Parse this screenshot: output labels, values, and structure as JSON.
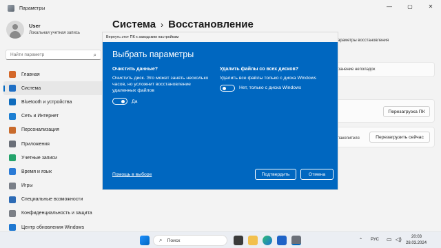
{
  "window": {
    "title": "Параметры",
    "minimize": "—",
    "maximize": "▢",
    "close": "✕"
  },
  "user": {
    "name": "User",
    "account_type": "Локальная учетная запись"
  },
  "search": {
    "placeholder": "Найти параметр"
  },
  "nav": [
    {
      "label": "Главная",
      "icon": "home-icon",
      "color": "#d4682a"
    },
    {
      "label": "Система",
      "icon": "monitor-icon",
      "color": "#1f6fc5",
      "active": true
    },
    {
      "label": "Bluetooth и устройства",
      "icon": "bluetooth-icon",
      "color": "#0f6cbd"
    },
    {
      "label": "Сеть и Интернет",
      "icon": "wifi-icon",
      "color": "#1d7fd2"
    },
    {
      "label": "Персонализация",
      "icon": "brush-icon",
      "color": "#c96b2c"
    },
    {
      "label": "Приложения",
      "icon": "apps-icon",
      "color": "#6a6f78"
    },
    {
      "label": "Учетные записи",
      "icon": "account-icon",
      "color": "#24a36b"
    },
    {
      "label": "Время и язык",
      "icon": "globe-clock-icon",
      "color": "#2b7bd6"
    },
    {
      "label": "Игры",
      "icon": "gamepad-icon",
      "color": "#7a7f88"
    },
    {
      "label": "Специальные возможности",
      "icon": "accessibility-icon",
      "color": "#2d6bb5"
    },
    {
      "label": "Конфиденциальность и защита",
      "icon": "shield-icon",
      "color": "#7b7f86"
    },
    {
      "label": "Центр обновления Windows",
      "icon": "update-icon",
      "color": "#1f78d1"
    }
  ],
  "page": {
    "section": "Система",
    "title": "Восстановление"
  },
  "background": {
    "partial_text_1": "араметры восстановления",
    "partial_text_2": "ранение неполадок",
    "partial_text_3": "пакопителя",
    "restart_button": "Перезагрузка ПК",
    "restart_now_button": "Перезагрузить сейчас"
  },
  "dialog": {
    "title": "Вернуть этот ПК к заводским настройкам",
    "heading": "Выбрать параметры",
    "clean": {
      "title": "Очистить данные?",
      "desc": [
        "Очистить диск. Это может занять несколько",
        "часов, но усложнит восстановление",
        "удаленных файлов"
      ],
      "toggle_label": "Да",
      "toggle_on": true
    },
    "drives": {
      "title": "Удалить файлы со всех дисков?",
      "desc": "Удалить все файлы только с диска Windows",
      "toggle_label": "Нет, только с диска Windows",
      "toggle_on": false
    },
    "help": "Помощь в выборе",
    "confirm": "Подтвердить",
    "cancel": "Отмена"
  },
  "taskbar": {
    "search": "Поиск",
    "lang": "РУС",
    "time": "20:03",
    "date": "28.03.2024"
  }
}
